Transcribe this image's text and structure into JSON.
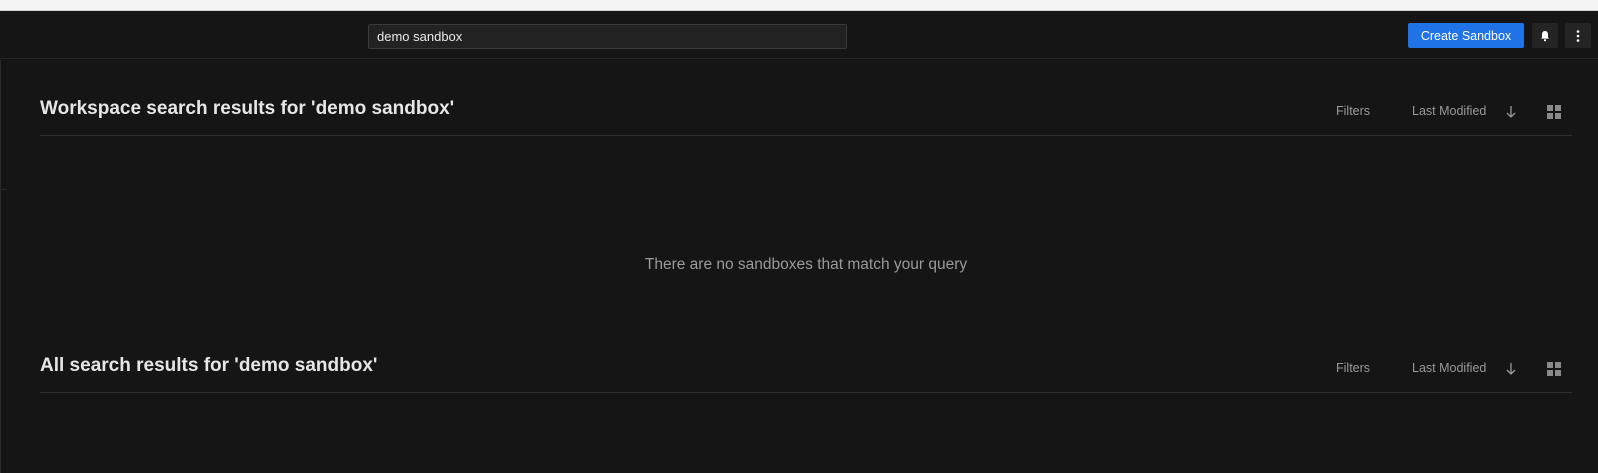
{
  "header": {
    "search_value": "demo sandbox",
    "create_label": "Create Sandbox",
    "accent_color": "#1f73e6"
  },
  "icons": {
    "notifications": "bell-icon",
    "menu": "more-vertical-icon",
    "sort_direction": "arrow-down-icon",
    "view_mode": "grid-view-icon"
  },
  "sections": [
    {
      "title": "Workspace search results for 'demo sandbox'",
      "filters_label": "Filters",
      "sort_label": "Last Modified",
      "empty_message": "There are no sandboxes that match your query"
    },
    {
      "title": "All search results for 'demo sandbox'",
      "filters_label": "Filters",
      "sort_label": "Last Modified"
    }
  ]
}
